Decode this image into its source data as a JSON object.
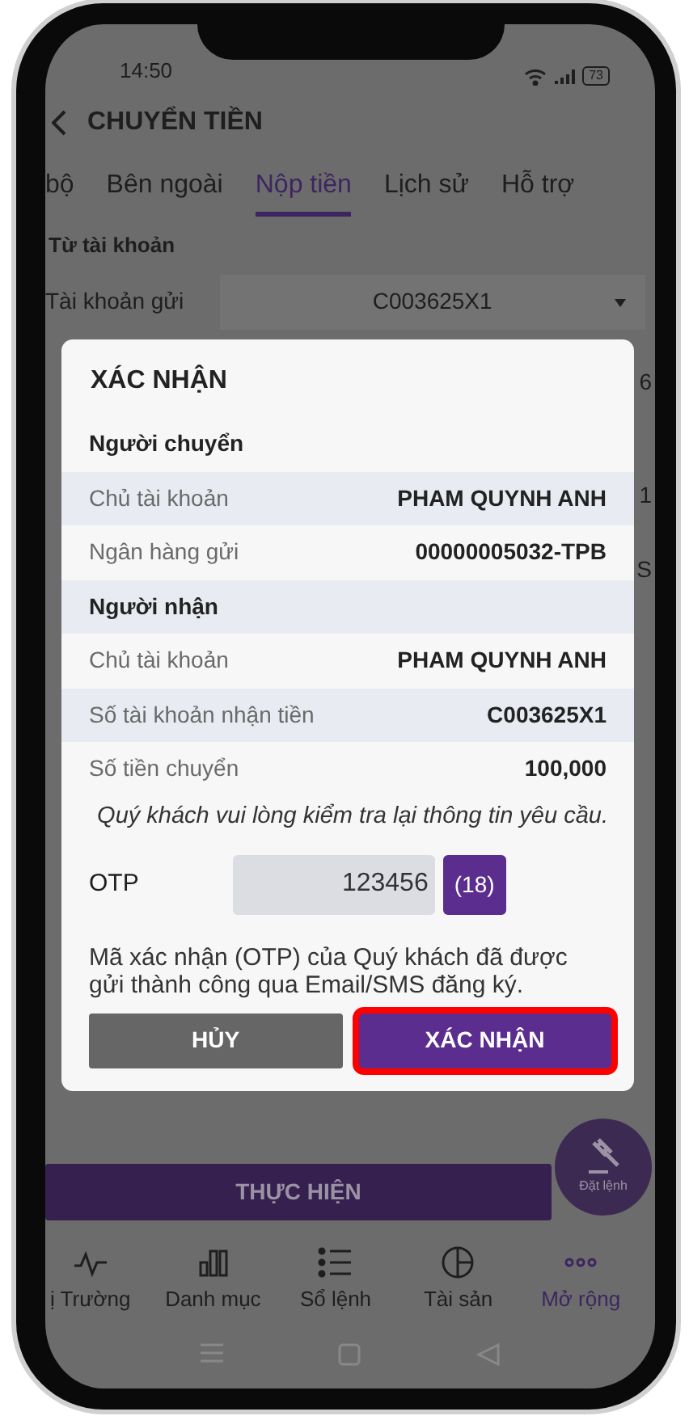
{
  "status_bar": {
    "time": "14:50",
    "battery": "73"
  },
  "header": {
    "title": "CHUYỂN TIỀN"
  },
  "tabs": [
    {
      "label": "bộ",
      "selected": false
    },
    {
      "label": "Bên ngoài",
      "selected": false
    },
    {
      "label": "Nộp tiền",
      "selected": true
    },
    {
      "label": "Lịch sử",
      "selected": false
    },
    {
      "label": "Hỗ trợ",
      "selected": false
    }
  ],
  "form": {
    "section": "Từ tài khoản",
    "account_label": "Tài khoản gửi",
    "account_value": "C003625X1",
    "peek_values": [
      "6",
      "1",
      "S"
    ]
  },
  "dialog": {
    "title": "XÁC NHẬN",
    "rows": [
      {
        "kind": "header",
        "label": "Người chuyển"
      },
      {
        "kind": "row",
        "label": "Chủ tài khoản",
        "value": "PHAM QUYNH ANH"
      },
      {
        "kind": "row",
        "label": "Ngân hàng gửi",
        "value": "00000005032-TPB"
      },
      {
        "kind": "header",
        "label": "Người nhận"
      },
      {
        "kind": "row",
        "label": "Chủ tài khoản",
        "value": "PHAM QUYNH ANH"
      },
      {
        "kind": "row",
        "label": "Số tài khoản nhận tiền",
        "value": "C003625X1"
      },
      {
        "kind": "row",
        "label": "Số tiền chuyển",
        "value": "100,000"
      }
    ],
    "note": "Quý khách vui lòng kiểm tra lại thông tin yêu cầu.",
    "otp": {
      "label": "OTP",
      "value": "123456",
      "countdown": "(18)"
    },
    "message": "Mã xác nhận (OTP) của Quý khách đã được gửi thành công qua Email/SMS đăng ký.",
    "buttons": [
      {
        "kind": "cancel",
        "label": "HỦY",
        "highlighted": false
      },
      {
        "kind": "confirm",
        "label": "XÁC NHẬN",
        "highlighted": true
      }
    ]
  },
  "submit_button": "THỰC HIỆN",
  "fab": {
    "label": "Đặt lệnh"
  },
  "bottom_nav": [
    {
      "label": "ị Trường",
      "selected": false
    },
    {
      "label": "Danh mục",
      "selected": false
    },
    {
      "label": "Sổ lệnh",
      "selected": false
    },
    {
      "label": "Tài sản",
      "selected": false
    },
    {
      "label": "Mở rộng",
      "selected": true
    }
  ]
}
